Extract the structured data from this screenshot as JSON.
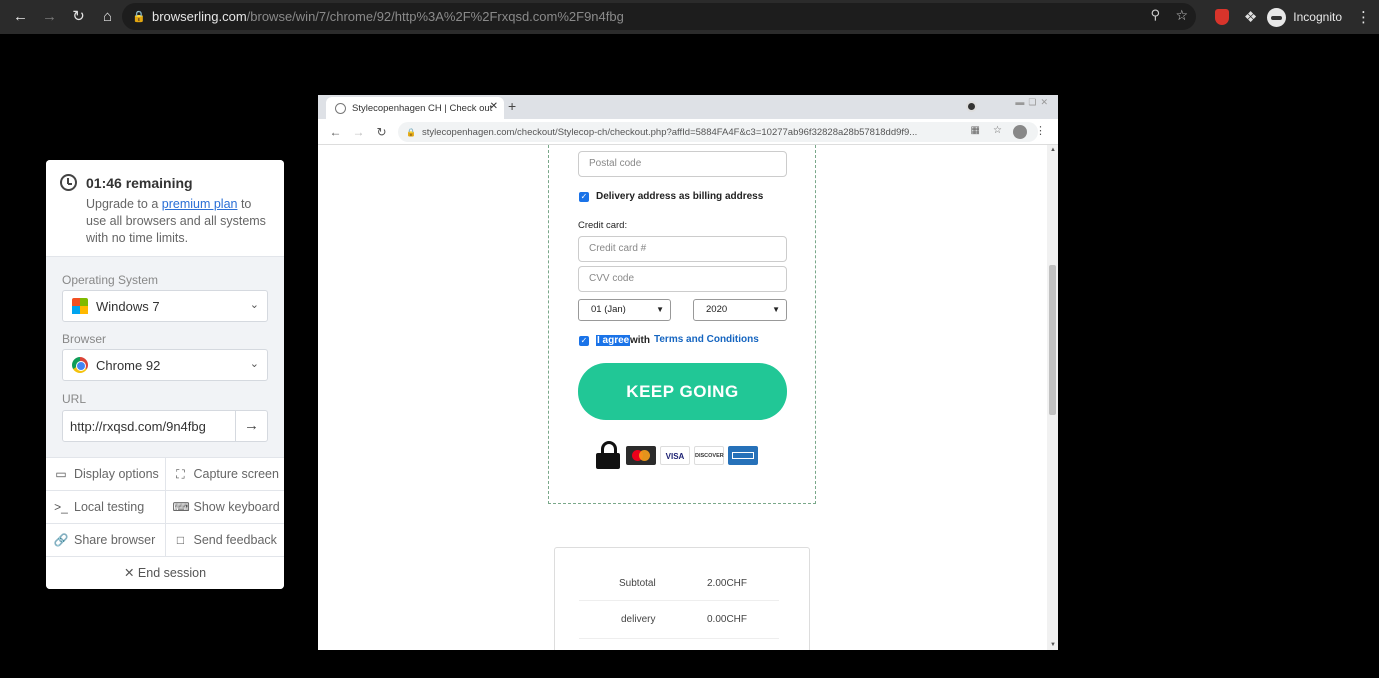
{
  "outer": {
    "url_host": "browserling.com",
    "url_path": "/browse/win/7/chrome/92/http%3A%2F%2Frxqsd.com%2F9n4fbg",
    "profile_label": "Incognito"
  },
  "panel": {
    "timer": "01:46 remaining",
    "upgrade_pre": "Upgrade to a ",
    "upgrade_link": "premium plan",
    "upgrade_post": " to use all browsers and all systems with no time limits.",
    "os_label": "Operating System",
    "os_value": "Windows 7",
    "browser_label": "Browser",
    "browser_value": "Chrome 92",
    "url_label": "URL",
    "url_value": "http://rxqsd.com/9n4fbg",
    "actions": {
      "display_options": "Display options",
      "capture_screen": "Capture screen",
      "local_testing": "Local testing",
      "show_keyboard": "Show keyboard",
      "share_browser": "Share browser",
      "send_feedback": "Send feedback",
      "end_session": "End session"
    }
  },
  "inner": {
    "tab_title": "Stylecopenhagen CH | Check out",
    "address": "stylecopenhagen.com/checkout/Stylecop-ch/checkout.php?affId=5884FA4F&c3=10277ab96f32828a28b57818dd9f9...",
    "form": {
      "postal_placeholder": "Postal code",
      "delivery_billing": "Delivery address as billing address",
      "credit_card_label": "Credit card:",
      "card_placeholder": "Credit card #",
      "cvv_placeholder": "CVV code",
      "month": "01 (Jan)",
      "year": "2020",
      "agree_highlight": "I agree",
      "agree_with": "with",
      "terms": "Terms and Conditions",
      "cta": "KEEP GOING",
      "cards": [
        "VISA",
        "DISCOVER"
      ]
    },
    "summary": {
      "subtotal_label": "Subtotal",
      "subtotal_value": "2.00CHF",
      "delivery_label": "delivery",
      "delivery_value": "0.00CHF"
    }
  },
  "colors": {
    "cta": "#21c796",
    "link": "#1a73e8",
    "terms": "#1565c0"
  }
}
